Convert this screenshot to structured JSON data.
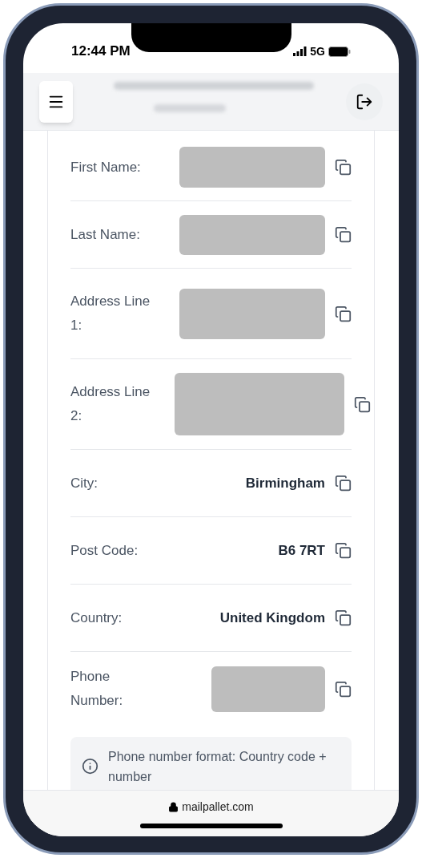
{
  "status_bar": {
    "time": "12:44 PM",
    "network": "5G"
  },
  "fields": [
    {
      "label": "First Name:",
      "kind": "redacted"
    },
    {
      "label": "Last Name:",
      "kind": "redacted"
    },
    {
      "label": "Address Line 1:",
      "kind": "redacted"
    },
    {
      "label": "Address Line 2:",
      "kind": "redacted"
    },
    {
      "label": "City:",
      "kind": "text",
      "value": "Birmingham"
    },
    {
      "label": "Post Code:",
      "kind": "text",
      "value": "B6 7RT"
    },
    {
      "label": "Country:",
      "kind": "text",
      "value": "United Kingdom"
    },
    {
      "label": "Phone Number:",
      "kind": "redacted"
    }
  ],
  "info_note": "Phone number format: Country code + number",
  "browser_bar": {
    "url": "mailpallet.com"
  }
}
